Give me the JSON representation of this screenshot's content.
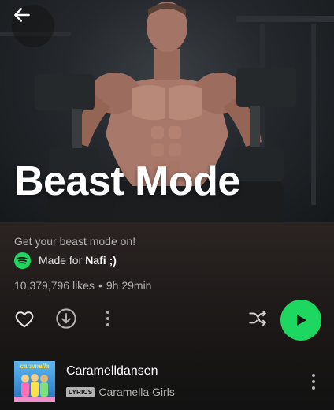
{
  "playlist": {
    "title": "Beast Mode",
    "description": "Get your beast mode on!",
    "made_for_prefix": "Made for",
    "made_for_user": "Nafi ;)",
    "likes": "10,379,796 likes",
    "separator": "•",
    "duration": "9h 29min"
  },
  "tracks": [
    {
      "title": "Caramelldansen",
      "badge": "LYRICS",
      "artist": "Caramella Girls",
      "cover_text": "caramella"
    }
  ],
  "colors": {
    "accent": "#1ed760",
    "background": "#121212",
    "secondary_text": "#b3b3b3"
  },
  "icons": {
    "back": "arrow-left-icon",
    "like": "heart-outline-icon",
    "download": "download-circle-icon",
    "more": "more-vertical-icon",
    "shuffle": "shuffle-icon",
    "play": "play-icon",
    "brand": "spotify-logo-icon"
  }
}
